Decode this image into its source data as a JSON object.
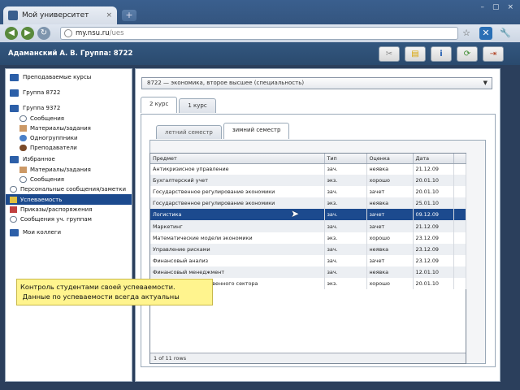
{
  "browser": {
    "tab_title": "Мой университет",
    "close_glyph": "×",
    "new_tab_glyph": "+",
    "window_controls": [
      "–",
      "▢",
      "×"
    ],
    "url_host": "my.nsu.ru",
    "url_path": "/ues",
    "back_glyph": "◀",
    "forward_glyph": "▶",
    "reload_glyph": "↻",
    "star_glyph": "☆",
    "extension_glyph": "✕",
    "wrench_glyph": "🔧"
  },
  "header": {
    "user": "Адаманский А. В.   Группа: 8722",
    "buttons": [
      {
        "icon": "tools-icon",
        "glyph": "✂"
      },
      {
        "icon": "note-icon",
        "glyph": "▤"
      },
      {
        "icon": "info-icon",
        "glyph": "i"
      },
      {
        "icon": "refresh-icon",
        "glyph": "⟳"
      },
      {
        "icon": "exit-icon",
        "glyph": "⇥"
      }
    ]
  },
  "sidebar": {
    "items": [
      {
        "label": "Преподаваемые курсы",
        "level": 0,
        "icon": "folder-icon"
      },
      {
        "label": "Группа 8722",
        "level": 0,
        "icon": "folder-icon"
      },
      {
        "label": "Группа 9372",
        "level": 0,
        "icon": "folder-icon"
      },
      {
        "label": "Сообщения",
        "level": 1,
        "icon": "messages-icon"
      },
      {
        "label": "Материалы/задания",
        "level": 1,
        "icon": "materials-icon"
      },
      {
        "label": "Одногруппники",
        "level": 1,
        "icon": "classmates-icon"
      },
      {
        "label": "Преподаватели",
        "level": 1,
        "icon": "teachers-icon"
      },
      {
        "label": "Избранное",
        "level": 0,
        "icon": "folder-icon"
      },
      {
        "label": "Материалы/задания",
        "level": 1,
        "icon": "materials-icon"
      },
      {
        "label": "Сообщения",
        "level": 1,
        "icon": "messages-icon"
      },
      {
        "label": "Персональные сообщения/заметки",
        "level": 0,
        "icon": "messages-icon"
      },
      {
        "label": "Успеваемость",
        "level": 0,
        "icon": "grades-icon",
        "selected": true
      },
      {
        "label": "Приказы/распоряжения",
        "level": 0,
        "icon": "orders-icon"
      },
      {
        "label": "Сообщения уч. группам",
        "level": 0,
        "icon": "messages-icon"
      },
      {
        "label": "Мои коллеги",
        "level": 0,
        "icon": "folder-icon"
      }
    ]
  },
  "main": {
    "group_select": "8722 — экономика, второе высшее (специальность)",
    "select_arrow": "▼",
    "year_tabs": [
      "2 курс",
      "1 курс"
    ],
    "semester_tabs": [
      "летний семестр",
      "зимний семестр"
    ],
    "table": {
      "columns": [
        "Предмет",
        "Тип",
        "Оценка",
        "Дата",
        ""
      ],
      "rows": [
        [
          "Антикризисное управление",
          "зач.",
          "неявка",
          "21.12.09"
        ],
        [
          "Бухгалтерский учет",
          "экз.",
          "хорошо",
          "20.01.10"
        ],
        [
          "Государственное регулирование экономики",
          "зач.",
          "зачет",
          "20.01.10"
        ],
        [
          "Государственное регулирование экономики",
          "экз.",
          "неявка",
          "25.01.10"
        ],
        [
          "Логистика",
          "зач.",
          "зачет",
          "09.12.09"
        ],
        [
          "Маркетинг",
          "зач.",
          "зачет",
          "21.12.09"
        ],
        [
          "Математические модели экономики",
          "экз.",
          "хорошо",
          "23.12.09"
        ],
        [
          "Управление рисками",
          "зач.",
          "неявка",
          "23.12.09"
        ],
        [
          "Финансовый анализ",
          "зач.",
          "зачет",
          "23.12.09"
        ],
        [
          "Финансовый менеджмент",
          "зач.",
          "неявка",
          "12.01.10"
        ],
        [
          "Экономика государственного сектора",
          "экз.",
          "хорошо",
          "20.01.10"
        ]
      ],
      "selected_row": 4,
      "footer": "1 of 11 rows"
    }
  },
  "callout": {
    "line1": "Контроль студентами своей успеваемости.",
    "line2": " Данные по успеваемости всегда актуальны"
  },
  "cursor_glyph": "➤"
}
